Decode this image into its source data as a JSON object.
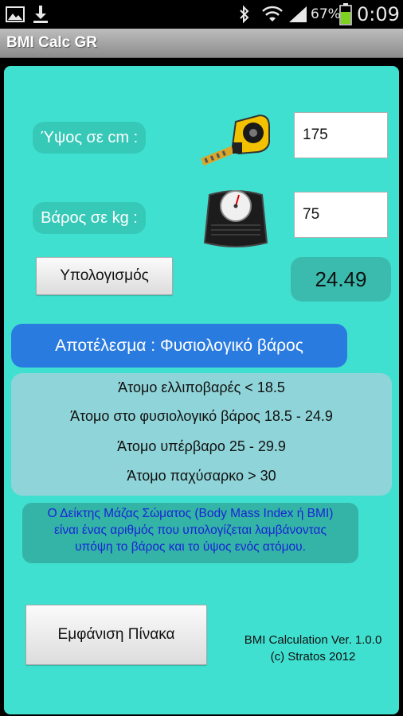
{
  "status_bar": {
    "battery_percent": "67%",
    "time": "0:09",
    "icons": [
      "gallery-icon",
      "download-icon",
      "bluetooth-icon",
      "wifi-icon",
      "signal-icon",
      "battery-icon"
    ]
  },
  "app": {
    "title": "BMI Calc GR"
  },
  "form": {
    "height_label": "Ύψος σε cm :",
    "height_value": "175",
    "weight_label": "Βάρος σε kg :",
    "weight_value": "75",
    "calculate_label": "Υπολογισμός",
    "bmi_result": "24.49"
  },
  "result": {
    "category_text": "Αποτέλεσμα : Φυσιολογικό βάρος"
  },
  "legend": [
    "Άτομο ελλιποβαρές < 18.5",
    "Άτομο στο φυσιολογικό βάρος 18.5 - 24.9",
    "Άτομο υπέρβαρο 25 - 29.9",
    "Άτομο παχύσαρκο > 30"
  ],
  "info_lines": [
    "Ο Δείκτης Μάζας Σώματος (Body Mass Index ή BMI)",
    "είναι ένας αριθμός που υπολογίζεται λαμβάνοντας",
    "υπόψη το βάρος και το ύψος ενός ατόμου."
  ],
  "footer": {
    "show_table_label": "Εμφάνιση  Πίνακα",
    "version_text": "BMI Calculation Ver. 1.0.0",
    "copyright_text": "(c) Stratos 2012"
  },
  "colors": {
    "panel_bg": "#40e0d0",
    "category_bar": "#2a7be0",
    "info_text": "#1a24d6",
    "battery_green": "#7ed321"
  }
}
